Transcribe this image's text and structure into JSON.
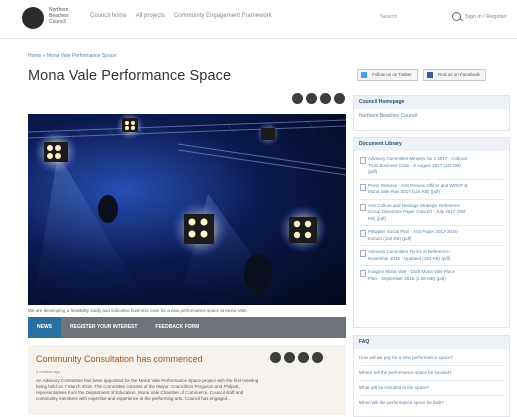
{
  "header": {
    "logo_text": "Northern Beaches Council",
    "nav": [
      "Council home",
      "All projects",
      "Community Engagement Framework"
    ],
    "search_label": "Search",
    "signin": "Sign in / Register"
  },
  "breadcrumb": "Home » Mona Vale Performance Space",
  "page_title": "Mona Vale Performance Space",
  "hero_caption": "We are developing a feasibility study and indicative business case for a new performance space at Mona Vale.",
  "tabs": [
    "NEWS",
    "REGISTER YOUR INTEREST",
    "FEEDBACK FORM"
  ],
  "consult": {
    "title": "Community Consultation has commenced",
    "date": "2 months ago",
    "body": [
      "An Advisory Committee has been appointed for the Mona Vale Performance Space project with the first meeting",
      "being held on 7 March 2018. The Committee consists of the Mayor, Councillors Ferguson and Philpott,",
      "representatives from the Department of Education, Mona Vale Chamber of Commerce, Council staff and",
      "community members with expertise and experience in the performing arts. Council has engaged..."
    ]
  },
  "sidebar": {
    "follow_twitter": "Follow us on Twitter",
    "find_facebook": "Find us on Facebook",
    "council_homepage": {
      "heading": "Council Homepage",
      "link": "Northern Beaches Council"
    },
    "document_library": {
      "heading": "Document Library",
      "docs": [
        [
          "Advisory Committee Minutes No 1 2017 - Cultural",
          "Trust Business Case - 6 August 2017 (110 KB)",
          "(pdf)"
        ],
        [
          "Press Release - Arts Review Officer and WDCP &",
          "Mona Vale Plan 2017 (116 KB) (pdf)"
        ],
        [
          "Arts Culture and Heritage Strategic Reference",
          "Group Directions Paper Concert - July 2017 (292",
          "KB) (pdf)"
        ],
        [
          "Pittwater Social Plan - Arts Paper 2012-2015 -",
          "Extract (182 KB) (pdf)"
        ],
        [
          "Advisory Committee Terms of Reference -",
          "November 2015 - Updated (194 KB) (pdf)"
        ],
        [
          "Imagine Mona Vale - Draft Mona Vale Place",
          "Plan - September 2015 (2.58 MB) (pdf)"
        ]
      ]
    },
    "faq": {
      "heading": "FAQ",
      "items": [
        "How will we pay for a new performance space?",
        "Where will the performance space be located?",
        "What will be included in the space?",
        "When will the performance space be built?"
      ]
    }
  }
}
